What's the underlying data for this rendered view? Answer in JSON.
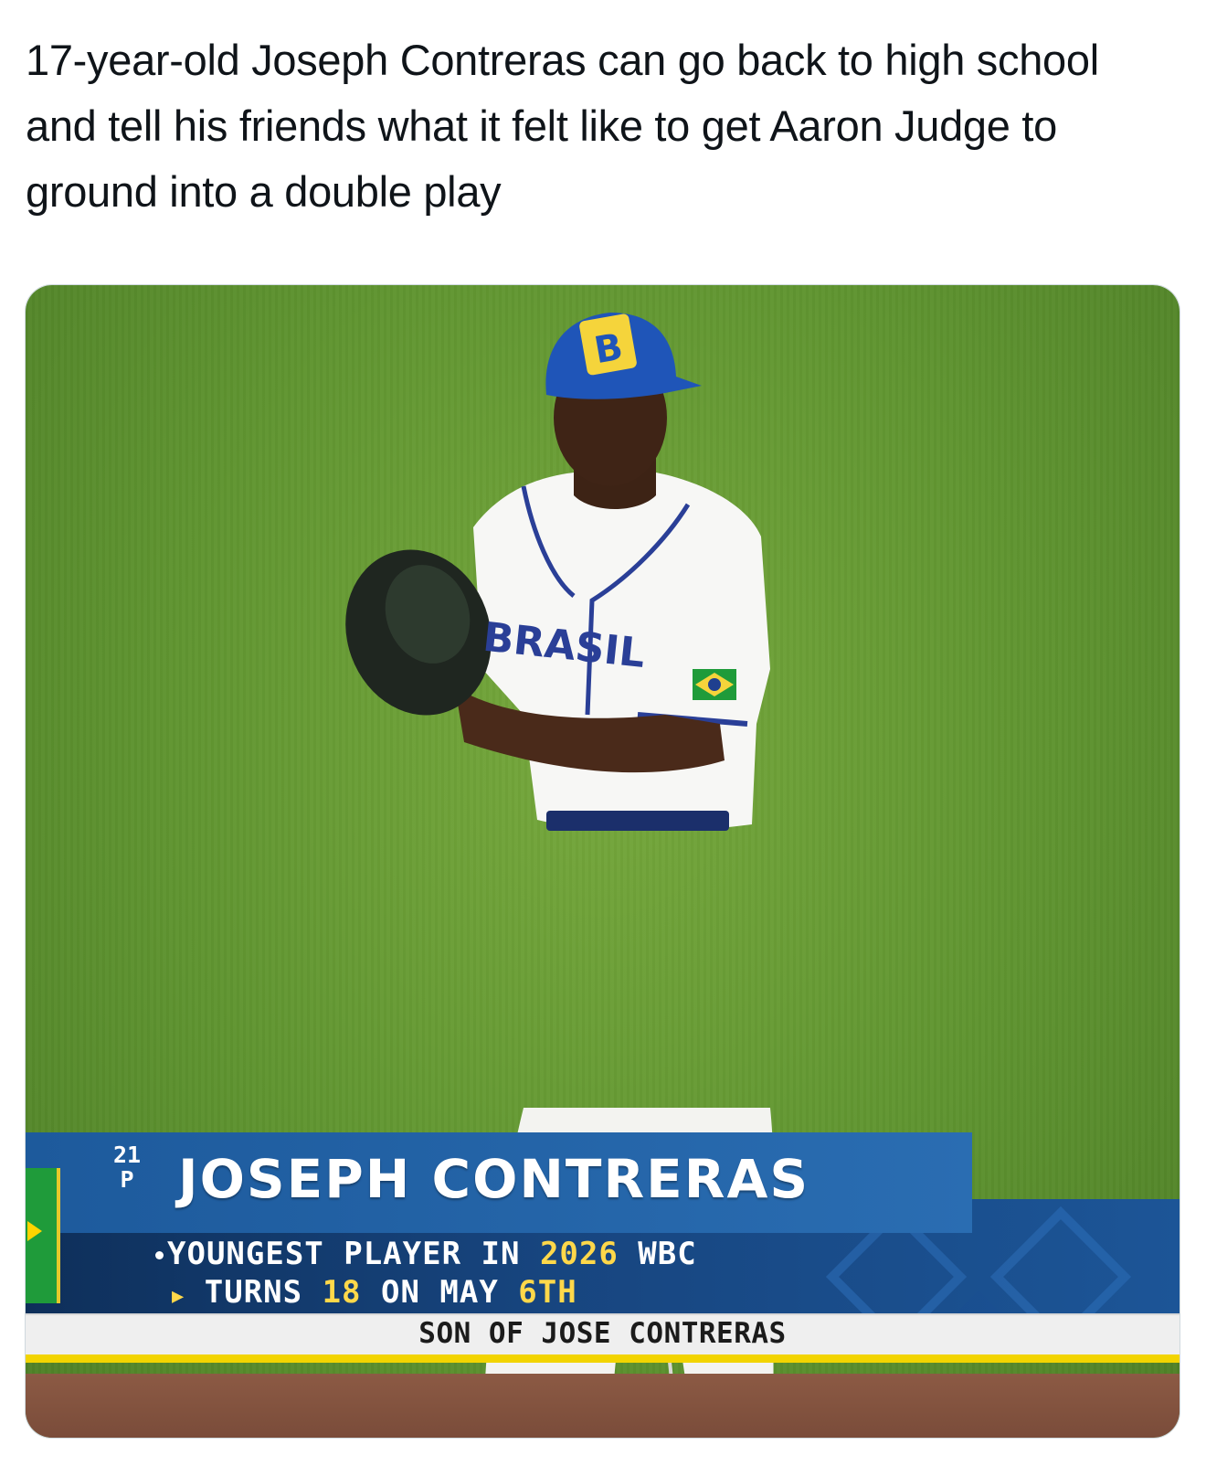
{
  "tweet": {
    "text": "17-year-old Joseph Contreras can go back to high school and tell his friends what it felt like to get Aaron Judge to ground into a double play"
  },
  "broadcast_graphic": {
    "number": "21",
    "position": "P",
    "name": "JOSEPH CONTRERAS",
    "line1_prefix": "YOUNGEST PLAYER IN ",
    "line1_year": "2026",
    "line1_suffix": " WBC",
    "line2_prefix": "TURNS ",
    "line2_age": "18",
    "line2_mid": " ON MAY ",
    "line2_day": "6TH",
    "footer": "SON OF JOSE CONTRERAS"
  },
  "jersey": {
    "cap_letter": "B",
    "chest_text": "BRASIL"
  },
  "colors": {
    "graphic_blue": "#1d5a9c",
    "graphic_dark": "#0e2f5a",
    "highlight_yellow": "#ffd84a",
    "field_green": "#5f9430",
    "cap_blue": "#1f55b8"
  }
}
